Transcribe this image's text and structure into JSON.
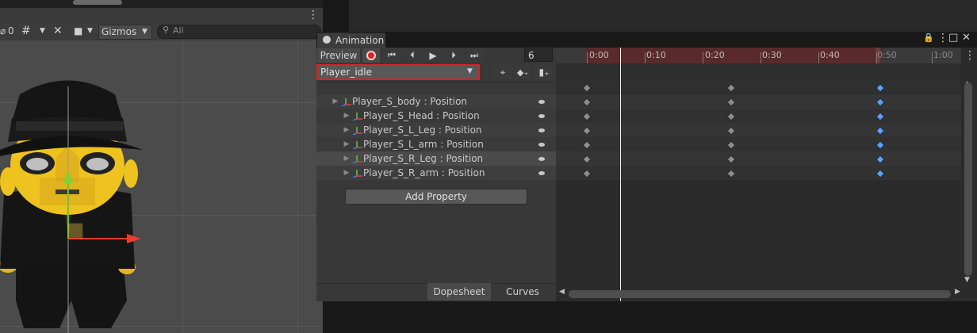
{
  "scene": {
    "stat_text": "0",
    "gizmos_label": "Gizmos",
    "search_placeholder": "All",
    "dots_label": "⋮"
  },
  "anim": {
    "tab_title": "Animation",
    "window_icons": [
      "🔒",
      "⋮",
      "□",
      "✕"
    ],
    "preview_label": "Preview",
    "frame_value": "6",
    "clip_name": "Player_idle",
    "ruler_labels": [
      "0:00",
      "0:10",
      "0:20",
      "0:30",
      "0:40",
      "0:50",
      "1:00"
    ],
    "properties": [
      {
        "label": "Player_S_body : Position"
      },
      {
        "label": "Player_S_Head : Position"
      },
      {
        "label": "Player_S_L_Leg : Position"
      },
      {
        "label": "Player_S_L_arm : Position"
      },
      {
        "label": "Player_S_R_Leg : Position"
      },
      {
        "label": "Player_S_R_arm : Position"
      }
    ],
    "add_property_label": "Add Property",
    "tabs": {
      "dopesheet": "Dopesheet",
      "curves": "Curves"
    },
    "accent_red": "#e0201d",
    "key_blue": "#5aa0ff"
  }
}
